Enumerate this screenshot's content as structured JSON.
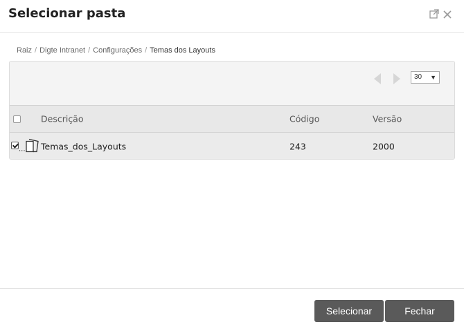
{
  "dialog": {
    "title": "Selecionar pasta"
  },
  "breadcrumb": {
    "items": [
      "Raiz",
      "Digte Intranet",
      "Configurações"
    ],
    "current": "Temas dos Layouts",
    "separator": "/"
  },
  "pager": {
    "page_size": "30"
  },
  "table": {
    "columns": [
      "Descrição",
      "Código",
      "Versão"
    ],
    "rows": [
      {
        "checked": true,
        "ellipsis": "...",
        "descricao": "Temas_dos_Layouts",
        "codigo": "243",
        "versao": "2000"
      }
    ]
  },
  "footer": {
    "select_label": "Selecionar",
    "close_label": "Fechar"
  },
  "colors": {
    "button_bg": "#5a5a5a",
    "header_bg": "#e8e8e8",
    "toolbar_bg": "#f4f4f4"
  },
  "icons": {
    "popout": "external-link-icon",
    "close": "close-icon",
    "folder": "folder-icon"
  }
}
